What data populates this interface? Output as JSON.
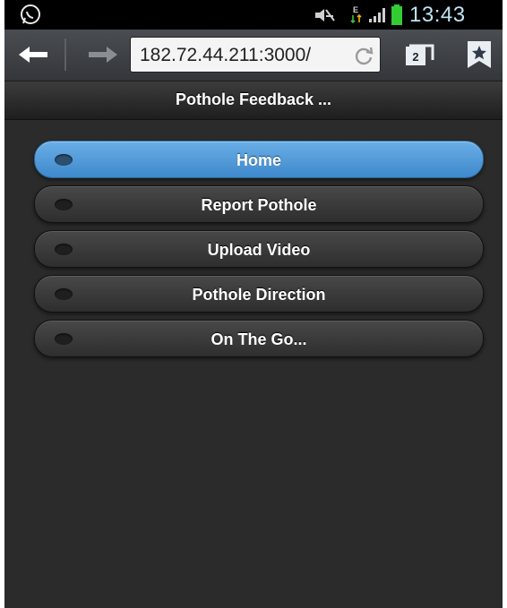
{
  "status_bar": {
    "time": "13:43",
    "icons": [
      "whatsapp-icon",
      "mute-icon",
      "data-transfer-icon",
      "signal-icon",
      "battery-icon"
    ],
    "colors": {
      "clock": "#bfe3f2",
      "battery": "#33cc33"
    }
  },
  "browser": {
    "url": "182.72.44.211:3000/",
    "tab_count": "2",
    "icons": [
      "back-arrow-icon",
      "forward-arrow-icon",
      "reload-icon",
      "tabs-icon",
      "bookmark-star-icon"
    ]
  },
  "page": {
    "title": "Pothole Feedback ..."
  },
  "menu": {
    "items": [
      {
        "label": "Home",
        "active": true
      },
      {
        "label": "Report Pothole",
        "active": false
      },
      {
        "label": "Upload Video",
        "active": false
      },
      {
        "label": "Pothole Direction",
        "active": false
      },
      {
        "label": "On The Go...",
        "active": false
      }
    ],
    "colors": {
      "active": "#4f9bdb",
      "inactive": "#3a3a3a"
    }
  }
}
